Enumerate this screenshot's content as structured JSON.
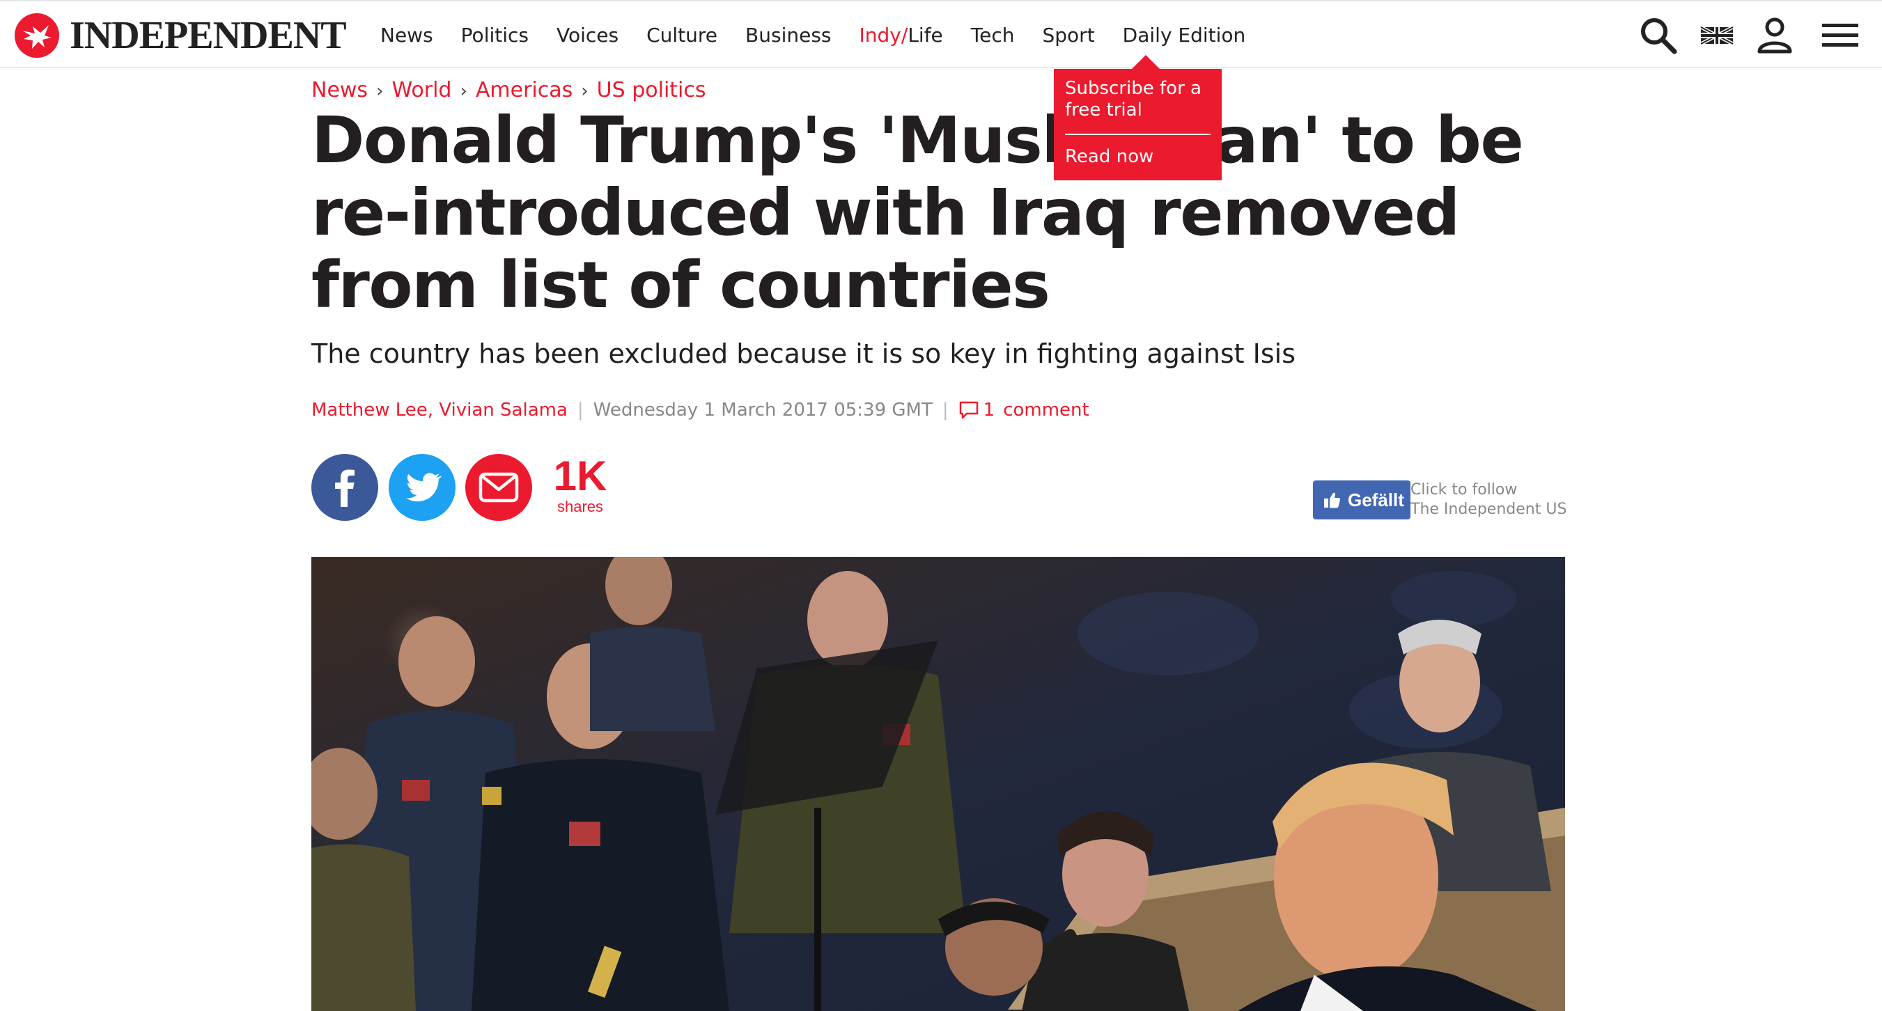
{
  "brand": {
    "name": "INDEPENDENT",
    "accent": "#ec1a2e"
  },
  "nav": {
    "items": [
      {
        "label": "News"
      },
      {
        "label": "Politics"
      },
      {
        "label": "Voices"
      },
      {
        "label": "Culture"
      },
      {
        "label": "Business"
      },
      {
        "label_red": "Indy/",
        "label_rest": "Life"
      },
      {
        "label": "Tech"
      },
      {
        "label": "Sport"
      },
      {
        "label": "Daily Edition"
      }
    ],
    "icons": [
      "search-icon",
      "uk-flag-icon",
      "user-icon",
      "menu-icon"
    ]
  },
  "popup": {
    "title": "Subscribe for a free trial",
    "link": "Read now"
  },
  "breadcrumb": [
    "News",
    "World",
    "Americas",
    "US politics"
  ],
  "article": {
    "headline": "Donald Trump's 'Muslim ban' to be re-introduced with Iraq removed from list of countries",
    "standfirst": "The country has been excluded because it is so key in fighting against Isis",
    "authors": "Matthew Lee, Vivian Salama",
    "date": "Wednesday 1 March 2017 05:39 GMT",
    "comment_count": "1",
    "comment_label": "comment"
  },
  "share": {
    "count": "1K",
    "label": "shares",
    "colors": {
      "facebook": "#3b5998",
      "twitter": "#1da1f2",
      "email": "#ec1a2e"
    }
  },
  "follow": {
    "like_label": "Gefällt",
    "line1": "Click to follow",
    "line2": "The Independent US"
  }
}
